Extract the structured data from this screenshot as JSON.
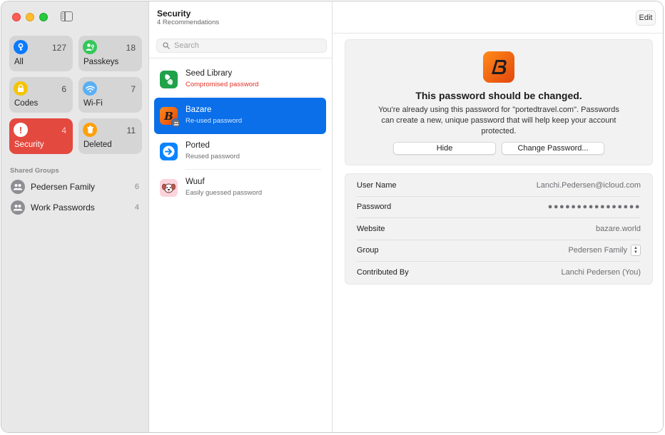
{
  "sidebar": {
    "tiles": [
      {
        "label": "All",
        "count": "127",
        "icon": "key-icon",
        "color": "#0a7aff"
      },
      {
        "label": "Passkeys",
        "count": "18",
        "icon": "passkey-icon",
        "color": "#34c759"
      },
      {
        "label": "Codes",
        "count": "6",
        "icon": "lock-clock-icon",
        "color": "#f5c400"
      },
      {
        "label": "Wi-Fi",
        "count": "7",
        "icon": "wifi-icon",
        "color": "#5ab0f5"
      },
      {
        "label": "Security",
        "count": "4",
        "icon": "exclamation-icon",
        "color": "#ffffff"
      },
      {
        "label": "Deleted",
        "count": "11",
        "icon": "trash-icon",
        "color": "#ff9f0a"
      }
    ],
    "groups_title": "Shared Groups",
    "groups": [
      {
        "label": "Pedersen Family",
        "count": "6"
      },
      {
        "label": "Work Passwords",
        "count": "4"
      }
    ]
  },
  "list": {
    "title": "Security",
    "subtitle": "4 Recommendations",
    "search_placeholder": "Search",
    "items": [
      {
        "title": "Seed Library",
        "subtitle": "Compromised password"
      },
      {
        "title": "Bazare",
        "subtitle": "Re-used password"
      },
      {
        "title": "Ported",
        "subtitle": "Reused password"
      },
      {
        "title": "Wuuf",
        "subtitle": "Easily guessed password"
      }
    ]
  },
  "detail": {
    "edit_label": "Edit",
    "warning_title": "This password should be changed.",
    "warning_body": "You're already using this password for \"portedtravel.com\". Passwords can create a new, unique password that will help keep your account protected.",
    "hide_label": "Hide",
    "change_label": "Change Password...",
    "fields": [
      {
        "label": "User Name",
        "value": "Lanchi.Pedersen@icloud.com"
      },
      {
        "label": "Password",
        "value": "●●●●●●●●●●●●●●●●"
      },
      {
        "label": "Website",
        "value": "bazare.world"
      },
      {
        "label": "Group",
        "value": "Pedersen Family"
      },
      {
        "label": "Contributed By",
        "value": "Lanchi Pedersen (You)"
      }
    ]
  },
  "colors": {
    "accent": "#0a6fe8",
    "security_red": "#e4493f",
    "compromised_red": "#e03127",
    "bazare_orange": "#ff7a14"
  }
}
